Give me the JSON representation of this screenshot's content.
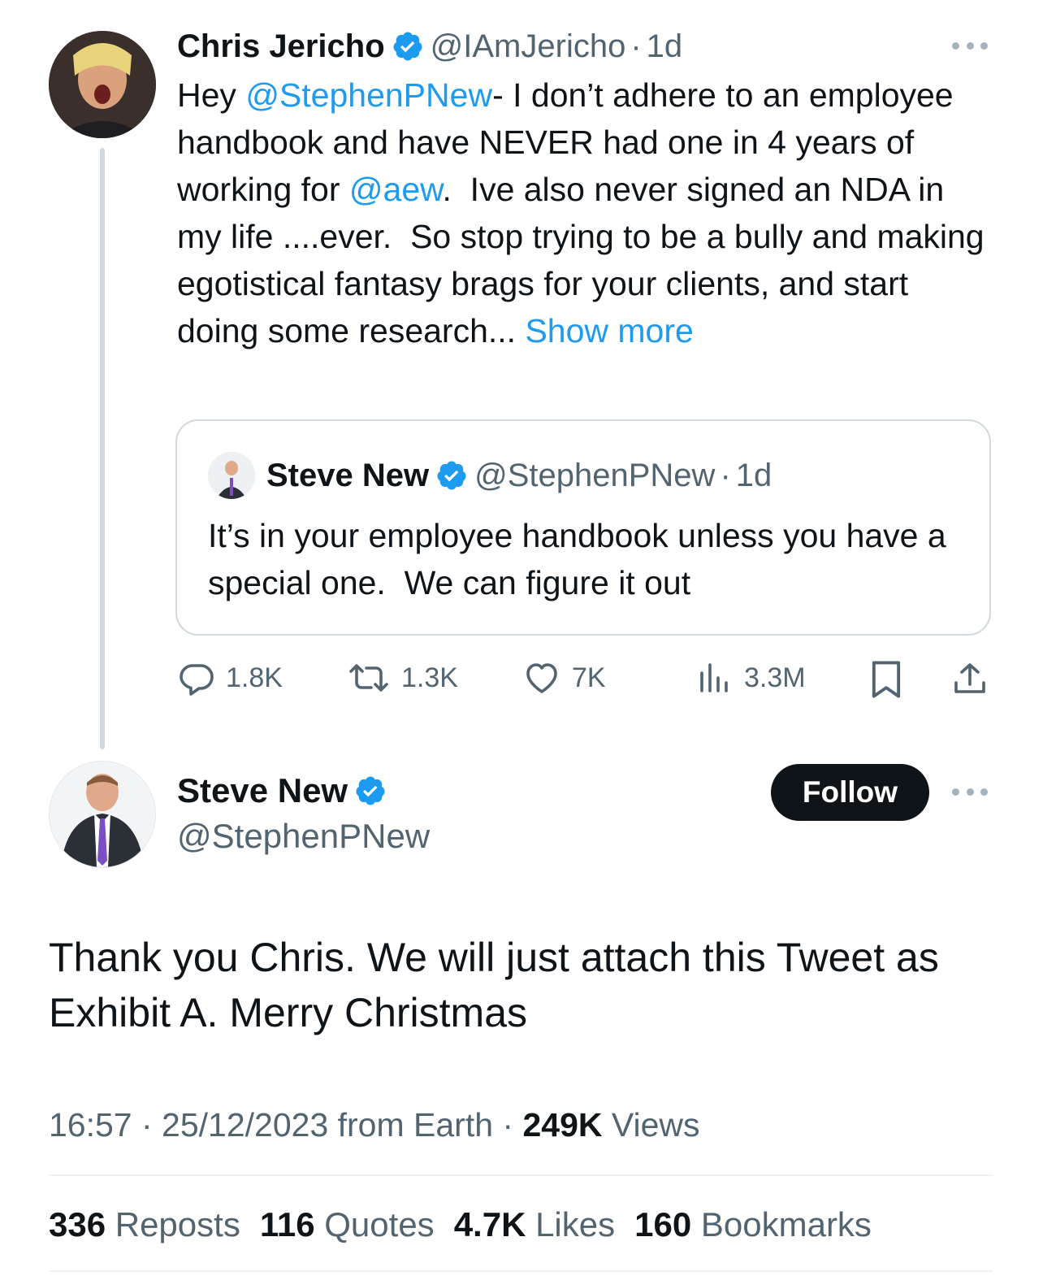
{
  "parent_tweet": {
    "author_name": "Chris Jericho",
    "handle": "@IAmJericho",
    "separator": "·",
    "age": "1d",
    "body": {
      "prefix": "Hey ",
      "mention1": "@StephenPNew",
      "part2": "- I don’t adhere to an employee handbook and have NEVER had one in 4 years of working for ",
      "mention2": "@aew",
      "part3": ".  Ive also never signed an NDA in my life ....ever.  So stop trying to be a bully and making egotistical fantasy brags for your clients, and start doing some research...",
      "show_more": " Show more"
    },
    "quoted": {
      "author_name": "Steve New",
      "handle": "@StephenPNew",
      "separator": "·",
      "age": "1d",
      "text": "It’s in your employee handbook unless you have a special one.  We can figure it out"
    },
    "actions": {
      "replies": "1.8K",
      "reposts": "1.3K",
      "likes": "7K",
      "views": "3.3M"
    }
  },
  "main_tweet": {
    "author_name": "Steve New",
    "handle": "@StephenPNew",
    "follow_label": "Follow",
    "text": "Thank you Chris. We will just attach this Tweet as Exhibit A. Merry Christmas",
    "meta": {
      "time": "16:57",
      "sep1": " · ",
      "date": "25/12/2023",
      "source": " from Earth",
      "sep2": " · ",
      "views_count": "249K",
      "views_label": " Views"
    },
    "stats": {
      "reposts_count": "336",
      "reposts_label": " Reposts",
      "quotes_count": "116",
      "quotes_label": " Quotes",
      "likes_count": "4.7K",
      "likes_label": " Likes",
      "bookmarks_count": "160",
      "bookmarks_label": " Bookmarks"
    }
  },
  "colors": {
    "link": "#1d9bf0",
    "verified": "#1d9bf0",
    "text": "#0f1419",
    "muted": "#536471",
    "border": "#cfd9de"
  },
  "icons": [
    "verified-badge-icon",
    "more-options-icon",
    "reply-icon",
    "repost-icon",
    "like-icon",
    "views-icon",
    "bookmark-icon",
    "share-icon"
  ]
}
